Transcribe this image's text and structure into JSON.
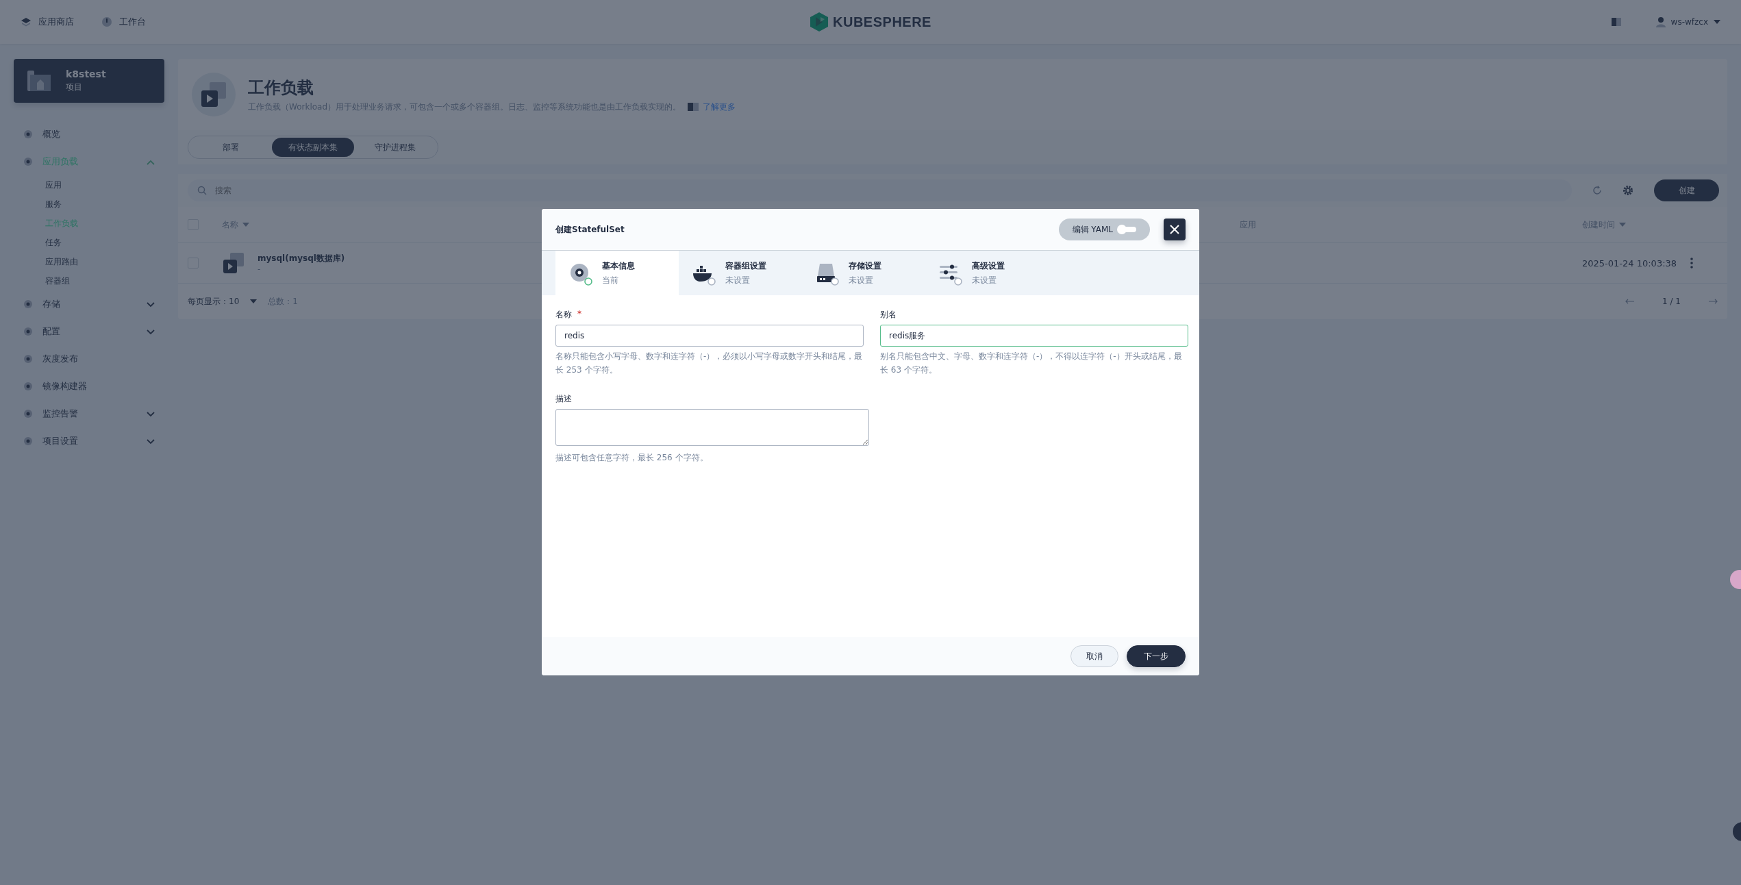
{
  "top_nav": {
    "items": [
      {
        "label": "应用商店"
      },
      {
        "label": "工作台"
      }
    ],
    "logo": "KUBESPHERE",
    "user": "ws-wfzcx"
  },
  "sidebar": {
    "project": {
      "name": "k8stest",
      "type": "项目"
    },
    "items": [
      {
        "label": "概览",
        "kind": "link",
        "selected": false
      },
      {
        "label": "应用负载",
        "kind": "group",
        "expanded": true,
        "selected": true,
        "children": [
          {
            "label": "应用",
            "selected": false
          },
          {
            "label": "服务",
            "selected": false
          },
          {
            "label": "工作负载",
            "selected": true
          },
          {
            "label": "任务",
            "selected": false
          },
          {
            "label": "应用路由",
            "selected": false
          },
          {
            "label": "容器组",
            "selected": false
          }
        ]
      },
      {
        "label": "存储",
        "kind": "group",
        "expanded": false,
        "selected": false
      },
      {
        "label": "配置",
        "kind": "group",
        "expanded": false,
        "selected": false
      },
      {
        "label": "灰度发布",
        "kind": "link",
        "selected": false
      },
      {
        "label": "镜像构建器",
        "kind": "link",
        "selected": false
      },
      {
        "label": "监控告警",
        "kind": "group",
        "expanded": false,
        "selected": false
      },
      {
        "label": "项目设置",
        "kind": "group",
        "expanded": false,
        "selected": false
      }
    ]
  },
  "page_header": {
    "title": "工作负载",
    "description": "工作负载（Workload）用于处理业务请求，可包含一个或多个容器组。日志、监控等系统功能也是由工作负载实现的。",
    "learn_more": "了解更多"
  },
  "tabs": [
    {
      "label": "部署",
      "selected": false
    },
    {
      "label": "有状态副本集",
      "selected": true
    },
    {
      "label": "守护进程集",
      "selected": false
    }
  ],
  "toolbar": {
    "search": {
      "placeholder": "搜索"
    },
    "create_button": "创建"
  },
  "table": {
    "select_all": {
      "checked": false
    },
    "columns": [
      "名称",
      "应用",
      "创建时间"
    ],
    "rows": [
      {
        "name": "mysql(mysql数据库)",
        "subtitle": "-",
        "created": "2025-01-24 10:03:38",
        "checked": false
      }
    ]
  },
  "pagination": {
    "page_size": "每页显示：10",
    "total": "总数：1",
    "page": "1 / 1"
  },
  "modal": {
    "title": "创建StatefulSet",
    "required_mark": "*",
    "yaml_toggle": {
      "label": "编辑 YAML",
      "on": false
    },
    "steps": [
      {
        "title": "基本信息",
        "status": "当前",
        "selected": true,
        "kind": "disk"
      },
      {
        "title": "容器组设置",
        "status": "未设置",
        "selected": false,
        "kind": "whale"
      },
      {
        "title": "存储设置",
        "status": "未设置",
        "selected": false,
        "kind": "storage"
      },
      {
        "title": "高级设置",
        "status": "未设置",
        "selected": false,
        "kind": "sliders"
      }
    ],
    "fields": {
      "name": {
        "label": "名称",
        "required": true,
        "value": "redis",
        "focused": false,
        "hint": "名称只能包含小写字母、数字和连字符（-），必须以小写字母或数字开头和结尾，最长 253 个字符。"
      },
      "alias": {
        "label": "别名",
        "required": false,
        "value": "redis服务",
        "focused": true,
        "hint": "别名只能包含中文、字母、数字和连字符（-），不得以连字符（-）开头或结尾，最长 63 个字符。"
      },
      "description": {
        "label": "描述",
        "hint": "描述可包含任意字符，最长 256 个字符。"
      }
    },
    "buttons": {
      "cancel": "取消",
      "next": "下一步"
    }
  }
}
